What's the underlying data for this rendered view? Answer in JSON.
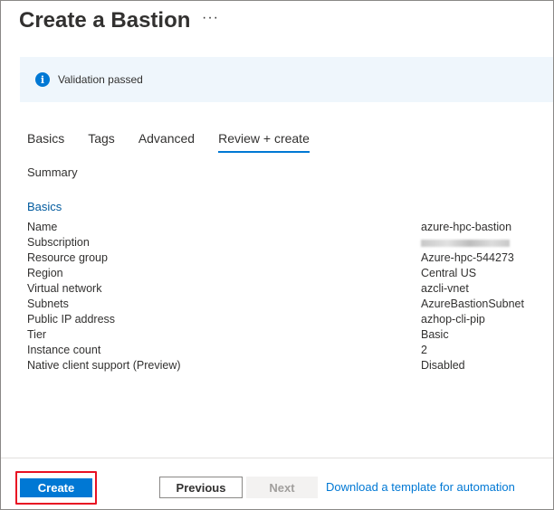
{
  "header": {
    "title": "Create a Bastion",
    "more_label": "···"
  },
  "banner": {
    "icon": "info-icon",
    "icon_glyph": "i",
    "text": "Validation passed"
  },
  "tabs": [
    {
      "label": "Basics",
      "active": false
    },
    {
      "label": "Tags",
      "active": false
    },
    {
      "label": "Advanced",
      "active": false
    },
    {
      "label": "Review + create",
      "active": true
    }
  ],
  "summary_label": "Summary",
  "section_title": "Basics",
  "rows": [
    {
      "label": "Name",
      "value": "azure-hpc-bastion"
    },
    {
      "label": "Subscription",
      "value": ""
    },
    {
      "label": "Resource group",
      "value": "Azure-hpc-544273"
    },
    {
      "label": "Region",
      "value": "Central US"
    },
    {
      "label": "Virtual network",
      "value": "azcli-vnet"
    },
    {
      "label": "Subnets",
      "value": "AzureBastionSubnet"
    },
    {
      "label": "Public IP address",
      "value": "azhop-cli-pip"
    },
    {
      "label": "Tier",
      "value": "Basic"
    },
    {
      "label": "Instance count",
      "value": "2"
    },
    {
      "label": "Native client support (Preview)",
      "value": "Disabled"
    }
  ],
  "footer": {
    "create_label": "Create",
    "previous_label": "Previous",
    "next_label": "Next",
    "template_link": "Download a template for automation"
  },
  "colors": {
    "accent": "#0078d4",
    "highlight_border": "#e81123",
    "banner_bg": "#eff6fc"
  }
}
